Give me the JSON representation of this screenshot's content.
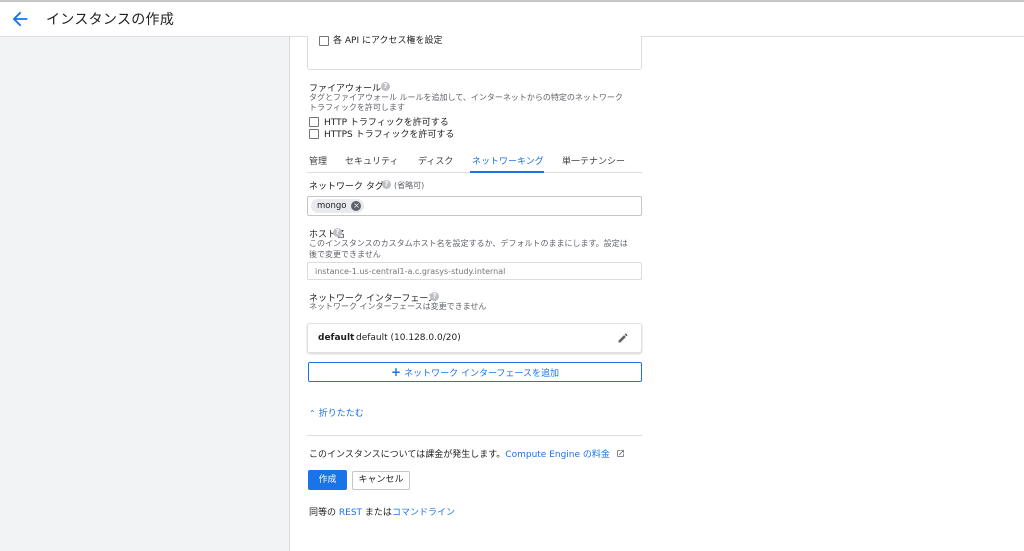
{
  "header": {
    "title": "インスタンスの作成"
  },
  "api_access": {
    "checkbox_label": "各 API にアクセス権を設定"
  },
  "firewall": {
    "title": "ファイアウォール",
    "description_line1": "タグとファイアウォール ルールを追加して、インターネットからの特定のネットワーク",
    "description_line2": "トラフィックを許可します",
    "http_label": "HTTP トラフィックを許可する",
    "https_label": "HTTPS トラフィックを許可する"
  },
  "tabs": [
    {
      "label": "管理"
    },
    {
      "label": "セキュリティ"
    },
    {
      "label": "ディスク"
    },
    {
      "label": "ネットワーキング"
    },
    {
      "label": "単一テナンシー"
    }
  ],
  "active_tab": "ネットワーキング",
  "network_tags": {
    "label": "ネットワーク タグ",
    "optional": "(省略可)",
    "tags": [
      "mongo"
    ]
  },
  "hostname": {
    "label": "ホスト名",
    "description_line1": "このインスタンスのカスタムホスト名を設定するか、デフォルトのままにします。設定は",
    "description_line2": "後で変更できません",
    "placeholder": "instance-1.us-central1-a.c.grasys-study.internal"
  },
  "network_interfaces": {
    "label": "ネットワーク インターフェース",
    "description": "ネットワーク インターフェースは変更できません",
    "items": [
      {
        "name": "default",
        "detail": "default (10.128.0.0/20)"
      }
    ],
    "add_label": "ネットワーク インターフェースを追加"
  },
  "collapse_label": "折りたたむ",
  "billing": {
    "text": "このインスタンスについては課金が発生します。",
    "link": "Compute Engine の料金"
  },
  "actions": {
    "create": "作成",
    "cancel": "キャンセル"
  },
  "footer": {
    "prefix": "同等の",
    "rest": "REST",
    "middle": "または",
    "cli": "コマンドライン"
  },
  "colors": {
    "accent": "#1a73e8",
    "left_pane": "#f1f3f4"
  }
}
